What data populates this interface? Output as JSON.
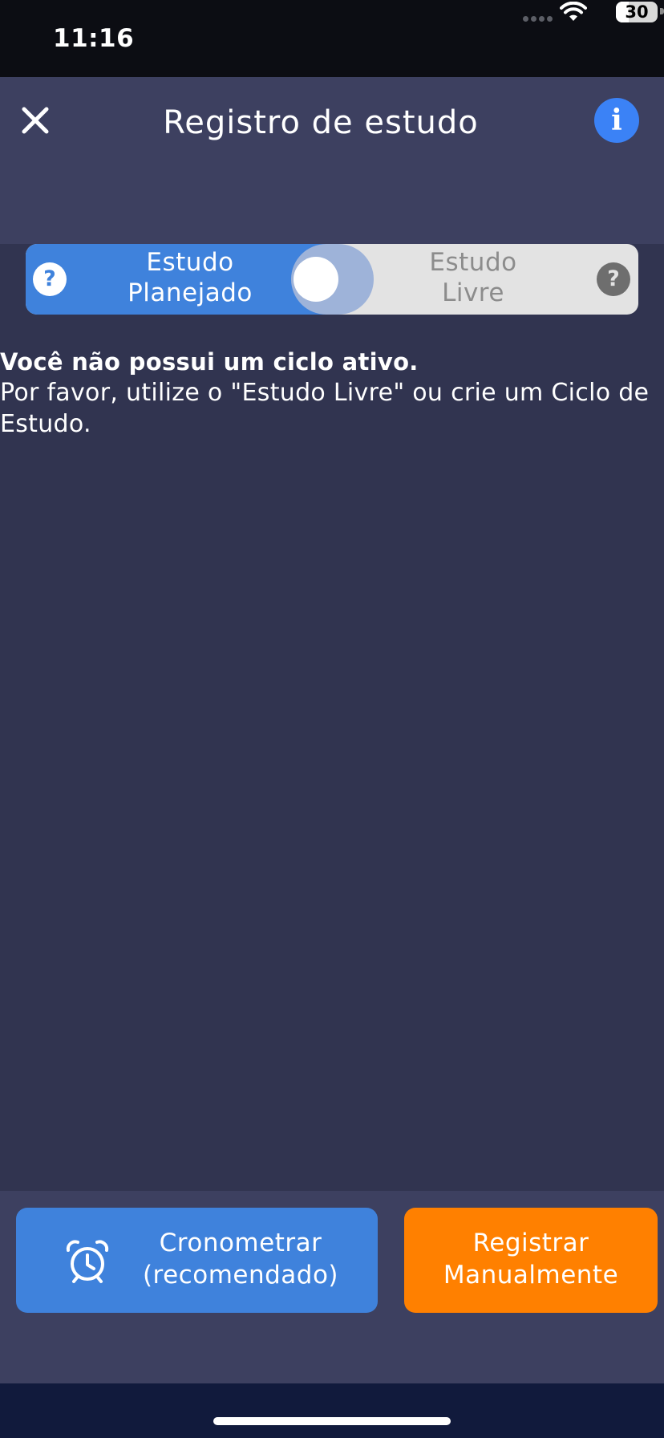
{
  "status_bar": {
    "time": "11:16",
    "battery": "30"
  },
  "header": {
    "title": "Registro de estudo",
    "close_icon": "close-icon",
    "info_icon": "info-icon",
    "info_glyph": "i"
  },
  "mode_toggle": {
    "left_label": "Estudo\nPlanejado",
    "right_label": "Estudo\nLivre",
    "help_glyph": "?",
    "selected": "Estudo Planejado",
    "active_color": "#3f82dc"
  },
  "message": {
    "title": "Você não possui um ciclo ativo.",
    "body": "Por favor, utilize o \"Estudo Livre\" ou crie um Ciclo de Estudo."
  },
  "actions": {
    "timer_label": "Cronometrar\n(recomendado)",
    "timer_icon": "alarm-clock-icon",
    "timer_color": "#3f82dc",
    "manual_label": "Registrar\nManualmente",
    "manual_color": "#ff8000"
  }
}
